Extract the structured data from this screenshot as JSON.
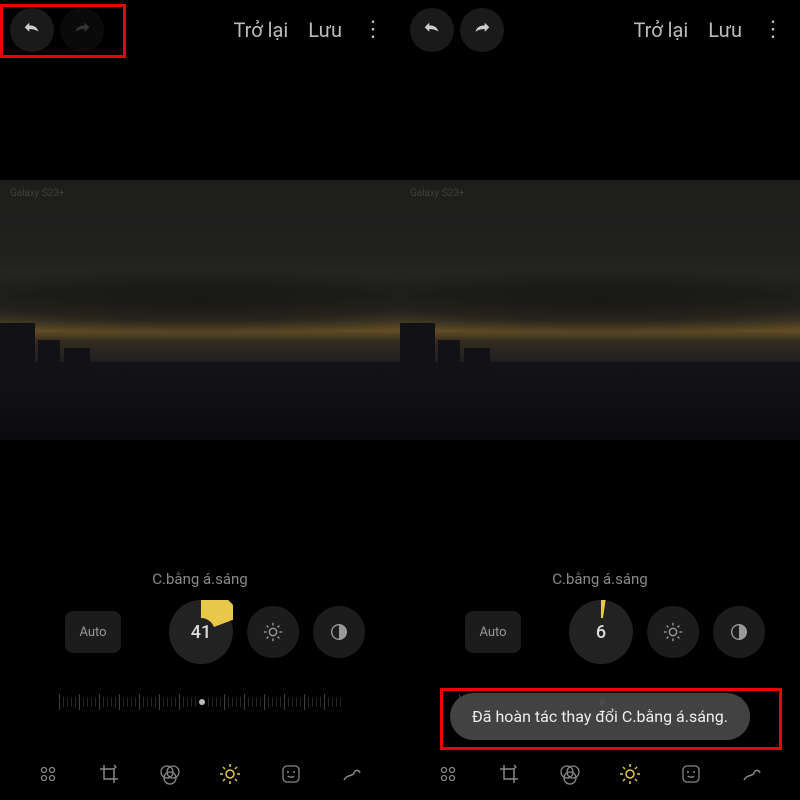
{
  "left": {
    "topbar": {
      "back_label": "Trở lại",
      "save_label": "Lưu"
    },
    "watermark": "Galaxy S23+",
    "adjustment_label": "C.bằng á.sáng",
    "adjustment_value": "41",
    "auto_label": "Auto"
  },
  "right": {
    "topbar": {
      "back_label": "Trở lại",
      "save_label": "Lưu"
    },
    "watermark": "Galaxy S23+",
    "adjustment_label": "C.bằng á.sáng",
    "adjustment_value": "6",
    "auto_label": "Auto",
    "toast_message": "Đã hoàn tác thay đổi C.bằng á.sáng."
  },
  "icons": {
    "undo": "undo-icon",
    "redo": "redo-icon",
    "brightness": "brightness-icon",
    "contrast": "contrast-icon",
    "ai": "ai-enhance-icon",
    "crop": "crop-rotate-icon",
    "filter": "filter-icon",
    "adjust": "adjust-icon",
    "sticker": "sticker-icon",
    "draw": "draw-icon"
  },
  "colors": {
    "accent": "#e8c848",
    "highlight_border": "#dd0000"
  }
}
